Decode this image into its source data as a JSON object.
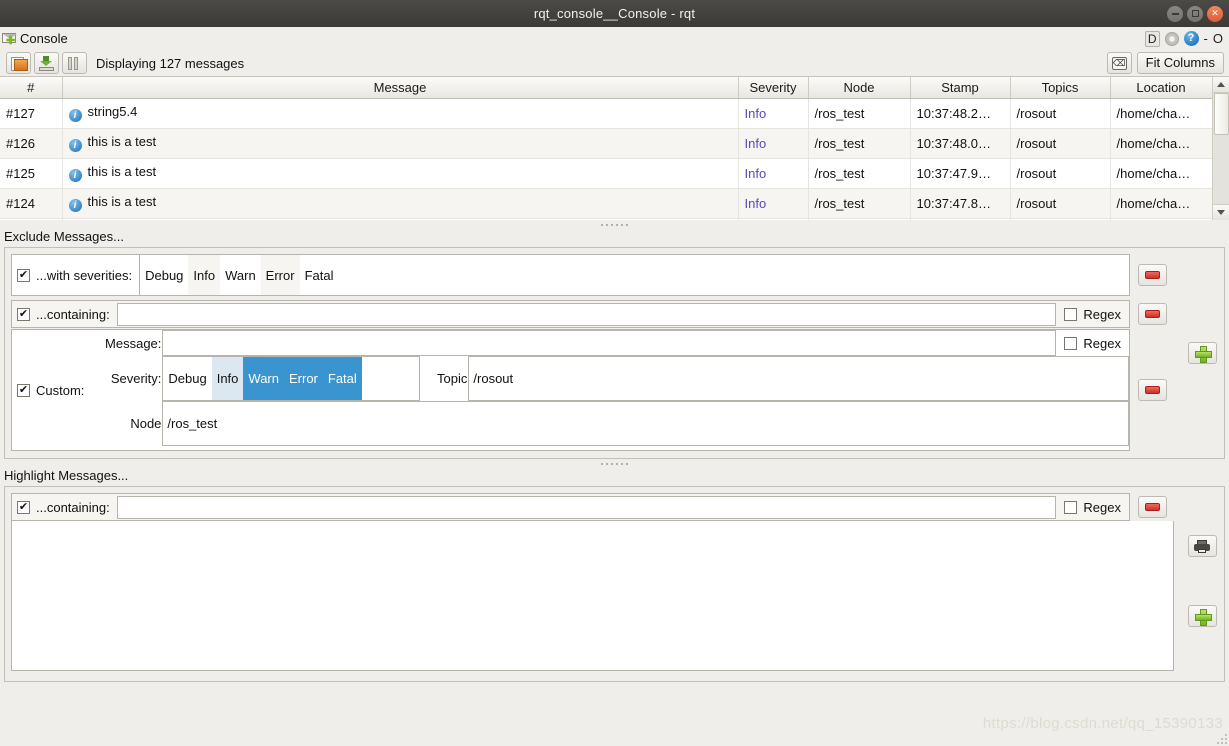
{
  "window": {
    "title": "rqt_console__Console - rqt",
    "buttons": {
      "minimize": "–",
      "maximize": "□",
      "close": "×"
    }
  },
  "plugin_header": {
    "tab_label": "Console",
    "icon": "envelope-add-icon",
    "dock_label": "D",
    "gear": "gear-icon",
    "help": "?",
    "minimize_glyph": "-",
    "restore_glyph": "O"
  },
  "toolbar": {
    "open_icon": "open-file-icon",
    "save_icon": "save-file-icon",
    "pause_icon": "pause-icon",
    "status_text": "Displaying 127 messages",
    "clear_icon": "clear-messages-icon",
    "fit_columns_label": "Fit Columns"
  },
  "table": {
    "columns": [
      "#",
      "Message",
      "Severity",
      "Node",
      "Stamp",
      "Topics",
      "Location"
    ],
    "rows": [
      {
        "num": "#127",
        "message": "string5.4",
        "severity": "Info",
        "node": "/ros_test",
        "stamp": "10:37:48.2…",
        "topics": "/rosout",
        "location": "/home/cha…"
      },
      {
        "num": "#126",
        "message": "this is a test",
        "severity": "Info",
        "node": "/ros_test",
        "stamp": "10:37:48.0…",
        "topics": "/rosout",
        "location": "/home/cha…"
      },
      {
        "num": "#125",
        "message": "this is a test",
        "severity": "Info",
        "node": "/ros_test",
        "stamp": "10:37:47.9…",
        "topics": "/rosout",
        "location": "/home/cha…"
      },
      {
        "num": "#124",
        "message": "this is a test",
        "severity": "Info",
        "node": "/ros_test",
        "stamp": "10:37:47.8…",
        "topics": "/rosout",
        "location": "/home/cha…"
      }
    ]
  },
  "exclude": {
    "title": "Exclude Messages...",
    "severities_row": {
      "checked": "✔",
      "label": "...with severities:",
      "items": [
        "Debug",
        "Info",
        "Warn",
        "Error",
        "Fatal"
      ],
      "remove_label": "remove-filter"
    },
    "containing_row": {
      "checked": "✔",
      "label": "...containing:",
      "value": "",
      "placeholder": "",
      "regex_label": "Regex",
      "regex_checked": "",
      "remove_label": "remove-filter"
    },
    "custom_row": {
      "checked": "✔",
      "label": "Custom:",
      "message_label": "Message:",
      "message_value": "",
      "regex_label": "Regex",
      "regex_checked": "",
      "severity_label": "Severity:",
      "severity_items": [
        "Debug",
        "Info",
        "Warn",
        "Error",
        "Fatal"
      ],
      "severity_selected": [
        "Warn",
        "Error",
        "Fatal"
      ],
      "severity_hovered": "Info",
      "topic_label": "Topic",
      "topic_value": "/rosout",
      "node_label": "Node",
      "node_value": "/ros_test",
      "remove_label": "remove-filter"
    },
    "add_label": "add-exclude-filter"
  },
  "highlight": {
    "title": "Highlight Messages...",
    "containing_row": {
      "checked": "✔",
      "label": "...containing:",
      "value": "",
      "regex_label": "Regex",
      "regex_checked": "",
      "remove_label": "remove-filter"
    },
    "print_label": "highlight-print-button",
    "add_label": "add-highlight-filter"
  },
  "watermark": "https://blog.csdn.net/qq_15390133",
  "colors": {
    "selection_blue": "#3a94cf",
    "severity_text": "#5a49b4",
    "window_bg": "#efeeea",
    "titlebar": "#3c3a37",
    "close_button": "#e0593b"
  }
}
